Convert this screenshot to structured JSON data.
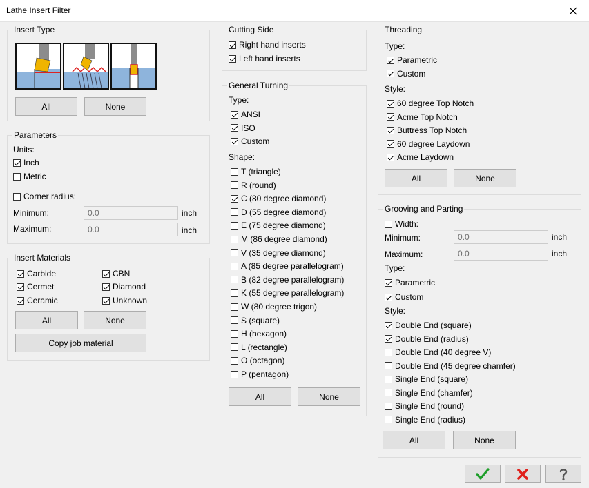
{
  "window": {
    "title": "Lathe Insert Filter"
  },
  "insert_type": {
    "legend": "Insert Type",
    "all_label": "All",
    "none_label": "None"
  },
  "parameters": {
    "legend": "Parameters",
    "units_label": "Units:",
    "inch": {
      "label": "Inch",
      "checked": true
    },
    "metric": {
      "label": "Metric",
      "checked": false
    },
    "corner_radius": {
      "label": "Corner radius:",
      "checked": false
    },
    "minimum_label": "Minimum:",
    "minimum_value": "0.0",
    "maximum_label": "Maximum:",
    "maximum_value": "0.0",
    "unit": "inch"
  },
  "insert_materials": {
    "legend": "Insert Materials",
    "items": [
      {
        "label": "Carbide",
        "checked": true
      },
      {
        "label": "Cermet",
        "checked": true
      },
      {
        "label": "Ceramic",
        "checked": true
      },
      {
        "label": "CBN",
        "checked": true
      },
      {
        "label": "Diamond",
        "checked": true
      },
      {
        "label": "Unknown",
        "checked": true
      }
    ],
    "all_label": "All",
    "none_label": "None",
    "copy_label": "Copy job material"
  },
  "cutting_side": {
    "legend": "Cutting Side",
    "items": [
      {
        "label": "Right hand inserts",
        "checked": true
      },
      {
        "label": "Left hand inserts",
        "checked": true
      }
    ]
  },
  "general_turning": {
    "legend": "General Turning",
    "type_label": "Type:",
    "types": [
      {
        "label": "ANSI",
        "checked": true
      },
      {
        "label": "ISO",
        "checked": true
      },
      {
        "label": "Custom",
        "checked": true
      }
    ],
    "shape_label": "Shape:",
    "shapes": [
      {
        "label": "T (triangle)",
        "checked": false
      },
      {
        "label": "R (round)",
        "checked": false
      },
      {
        "label": "C (80 degree diamond)",
        "checked": true
      },
      {
        "label": "D (55 degree diamond)",
        "checked": false
      },
      {
        "label": "E (75 degree diamond)",
        "checked": false
      },
      {
        "label": "M (86 degree diamond)",
        "checked": false
      },
      {
        "label": "V (35 degree diamond)",
        "checked": false
      },
      {
        "label": "A (85 degree parallelogram)",
        "checked": false
      },
      {
        "label": "B (82 degree parallelogram)",
        "checked": false
      },
      {
        "label": "K (55 degree parallelogram)",
        "checked": false
      },
      {
        "label": "W (80 degree trigon)",
        "checked": false
      },
      {
        "label": "S (square)",
        "checked": false
      },
      {
        "label": "H (hexagon)",
        "checked": false
      },
      {
        "label": "L (rectangle)",
        "checked": false
      },
      {
        "label": "O (octagon)",
        "checked": false
      },
      {
        "label": "P (pentagon)",
        "checked": false
      }
    ],
    "all_label": "All",
    "none_label": "None"
  },
  "threading": {
    "legend": "Threading",
    "type_label": "Type:",
    "types": [
      {
        "label": "Parametric",
        "checked": true
      },
      {
        "label": "Custom",
        "checked": true
      }
    ],
    "style_label": "Style:",
    "styles": [
      {
        "label": "60 degree Top Notch",
        "checked": true
      },
      {
        "label": "Acme Top Notch",
        "checked": true
      },
      {
        "label": "Buttress Top Notch",
        "checked": true
      },
      {
        "label": "60 degree Laydown",
        "checked": true
      },
      {
        "label": "Acme Laydown",
        "checked": true
      }
    ],
    "all_label": "All",
    "none_label": "None"
  },
  "grooving": {
    "legend": "Grooving and Parting",
    "width": {
      "label": "Width:",
      "checked": false
    },
    "minimum_label": "Minimum:",
    "minimum_value": "0.0",
    "maximum_label": "Maximum:",
    "maximum_value": "0.0",
    "unit": "inch",
    "type_label": "Type:",
    "types": [
      {
        "label": "Parametric",
        "checked": true
      },
      {
        "label": "Custom",
        "checked": true
      }
    ],
    "style_label": "Style:",
    "styles": [
      {
        "label": "Double End (square)",
        "checked": true
      },
      {
        "label": "Double End (radius)",
        "checked": true
      },
      {
        "label": "Double End (40 degree V)",
        "checked": false
      },
      {
        "label": "Double End (45 degree chamfer)",
        "checked": false
      },
      {
        "label": "Single End (square)",
        "checked": false
      },
      {
        "label": "Single End (chamfer)",
        "checked": false
      },
      {
        "label": "Single End (round)",
        "checked": false
      },
      {
        "label": "Single End (radius)",
        "checked": false
      }
    ],
    "all_label": "All",
    "none_label": "None"
  },
  "footer": {
    "ok_icon": "check-icon",
    "cancel_icon": "x-icon",
    "help_icon": "question-icon",
    "ok_color": "#1e9e2a",
    "cancel_color": "#e0201b"
  }
}
